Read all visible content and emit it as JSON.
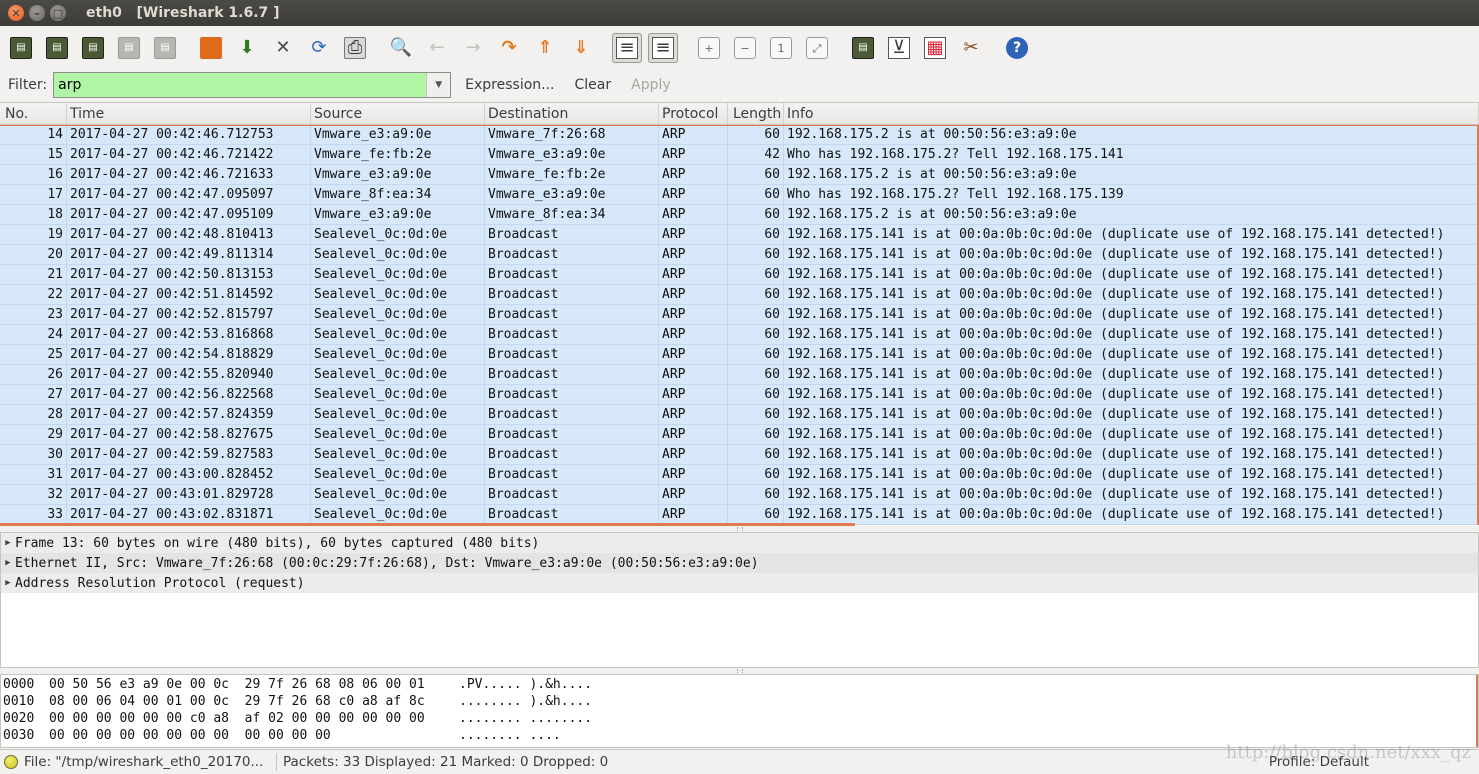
{
  "window": {
    "title": "eth0   [Wireshark 1.6.7 ]",
    "close_glyph": "✕",
    "min_glyph": "–",
    "max_glyph": "□"
  },
  "toolbar": {
    "buttons": [
      {
        "name": "interfaces-list-icon",
        "glyph": "▤"
      },
      {
        "name": "capture-options-icon",
        "glyph": "▤"
      },
      {
        "name": "start-capture-icon",
        "glyph": "▤"
      },
      {
        "name": "stop-capture-icon",
        "glyph": "▤"
      },
      {
        "name": "restart-capture-icon",
        "glyph": "▤"
      },
      {
        "name": "open-file-icon",
        "glyph": ""
      },
      {
        "name": "save-file-icon",
        "glyph": "⬇"
      },
      {
        "name": "close-file-icon",
        "glyph": "✕"
      },
      {
        "name": "reload-icon",
        "glyph": "⟳"
      },
      {
        "name": "print-icon",
        "glyph": "⎙"
      },
      {
        "name": "find-packet-icon",
        "glyph": "🔍"
      },
      {
        "name": "go-back-icon",
        "glyph": "←"
      },
      {
        "name": "go-forward-icon",
        "glyph": "→"
      },
      {
        "name": "go-to-packet-icon",
        "glyph": "↷"
      },
      {
        "name": "go-first-packet-icon",
        "glyph": "⇑"
      },
      {
        "name": "go-last-packet-icon",
        "glyph": "⇓"
      },
      {
        "name": "colorize-icon",
        "glyph": "≡"
      },
      {
        "name": "auto-scroll-icon",
        "glyph": "≡"
      },
      {
        "name": "zoom-in-icon",
        "glyph": "+"
      },
      {
        "name": "zoom-out-icon",
        "glyph": "−"
      },
      {
        "name": "normal-size-icon",
        "glyph": "1"
      },
      {
        "name": "resize-columns-icon",
        "glyph": "⤢"
      },
      {
        "name": "capture-filters-icon",
        "glyph": "▤"
      },
      {
        "name": "display-filters-icon",
        "glyph": "⊻"
      },
      {
        "name": "coloring-rules-icon",
        "glyph": "▦"
      },
      {
        "name": "preferences-icon",
        "glyph": "✂"
      },
      {
        "name": "help-icon",
        "glyph": "?"
      }
    ]
  },
  "filter": {
    "label": "Filter:",
    "value": "arp",
    "expression_label": "Expression...",
    "clear_label": "Clear",
    "apply_label": "Apply",
    "field_color": "#b1f6a6"
  },
  "packet_list": {
    "columns": [
      "No.",
      "Time",
      "Source",
      "Destination",
      "Protocol",
      "Length",
      "Info"
    ],
    "row_color": "#d6e8fa",
    "rows": [
      {
        "no": "14",
        "time": "2017-04-27 00:42:46.712753",
        "src": "Vmware_e3:a9:0e",
        "dst": "Vmware_7f:26:68",
        "proto": "ARP",
        "len": "60",
        "info": "192.168.175.2 is at 00:50:56:e3:a9:0e"
      },
      {
        "no": "15",
        "time": "2017-04-27 00:42:46.721422",
        "src": "Vmware_fe:fb:2e",
        "dst": "Vmware_e3:a9:0e",
        "proto": "ARP",
        "len": "42",
        "info": "Who has 192.168.175.2?  Tell 192.168.175.141"
      },
      {
        "no": "16",
        "time": "2017-04-27 00:42:46.721633",
        "src": "Vmware_e3:a9:0e",
        "dst": "Vmware_fe:fb:2e",
        "proto": "ARP",
        "len": "60",
        "info": "192.168.175.2 is at 00:50:56:e3:a9:0e"
      },
      {
        "no": "17",
        "time": "2017-04-27 00:42:47.095097",
        "src": "Vmware_8f:ea:34",
        "dst": "Vmware_e3:a9:0e",
        "proto": "ARP",
        "len": "60",
        "info": "Who has 192.168.175.2?  Tell 192.168.175.139"
      },
      {
        "no": "18",
        "time": "2017-04-27 00:42:47.095109",
        "src": "Vmware_e3:a9:0e",
        "dst": "Vmware_8f:ea:34",
        "proto": "ARP",
        "len": "60",
        "info": "192.168.175.2 is at 00:50:56:e3:a9:0e"
      },
      {
        "no": "19",
        "time": "2017-04-27 00:42:48.810413",
        "src": "Sealevel_0c:0d:0e",
        "dst": "Broadcast",
        "proto": "ARP",
        "len": "60",
        "info": "192.168.175.141 is at 00:0a:0b:0c:0d:0e (duplicate use of 192.168.175.141 detected!)"
      },
      {
        "no": "20",
        "time": "2017-04-27 00:42:49.811314",
        "src": "Sealevel_0c:0d:0e",
        "dst": "Broadcast",
        "proto": "ARP",
        "len": "60",
        "info": "192.168.175.141 is at 00:0a:0b:0c:0d:0e (duplicate use of 192.168.175.141 detected!)"
      },
      {
        "no": "21",
        "time": "2017-04-27 00:42:50.813153",
        "src": "Sealevel_0c:0d:0e",
        "dst": "Broadcast",
        "proto": "ARP",
        "len": "60",
        "info": "192.168.175.141 is at 00:0a:0b:0c:0d:0e (duplicate use of 192.168.175.141 detected!)"
      },
      {
        "no": "22",
        "time": "2017-04-27 00:42:51.814592",
        "src": "Sealevel_0c:0d:0e",
        "dst": "Broadcast",
        "proto": "ARP",
        "len": "60",
        "info": "192.168.175.141 is at 00:0a:0b:0c:0d:0e (duplicate use of 192.168.175.141 detected!)"
      },
      {
        "no": "23",
        "time": "2017-04-27 00:42:52.815797",
        "src": "Sealevel_0c:0d:0e",
        "dst": "Broadcast",
        "proto": "ARP",
        "len": "60",
        "info": "192.168.175.141 is at 00:0a:0b:0c:0d:0e (duplicate use of 192.168.175.141 detected!)"
      },
      {
        "no": "24",
        "time": "2017-04-27 00:42:53.816868",
        "src": "Sealevel_0c:0d:0e",
        "dst": "Broadcast",
        "proto": "ARP",
        "len": "60",
        "info": "192.168.175.141 is at 00:0a:0b:0c:0d:0e (duplicate use of 192.168.175.141 detected!)"
      },
      {
        "no": "25",
        "time": "2017-04-27 00:42:54.818829",
        "src": "Sealevel_0c:0d:0e",
        "dst": "Broadcast",
        "proto": "ARP",
        "len": "60",
        "info": "192.168.175.141 is at 00:0a:0b:0c:0d:0e (duplicate use of 192.168.175.141 detected!)"
      },
      {
        "no": "26",
        "time": "2017-04-27 00:42:55.820940",
        "src": "Sealevel_0c:0d:0e",
        "dst": "Broadcast",
        "proto": "ARP",
        "len": "60",
        "info": "192.168.175.141 is at 00:0a:0b:0c:0d:0e (duplicate use of 192.168.175.141 detected!)"
      },
      {
        "no": "27",
        "time": "2017-04-27 00:42:56.822568",
        "src": "Sealevel_0c:0d:0e",
        "dst": "Broadcast",
        "proto": "ARP",
        "len": "60",
        "info": "192.168.175.141 is at 00:0a:0b:0c:0d:0e (duplicate use of 192.168.175.141 detected!)"
      },
      {
        "no": "28",
        "time": "2017-04-27 00:42:57.824359",
        "src": "Sealevel_0c:0d:0e",
        "dst": "Broadcast",
        "proto": "ARP",
        "len": "60",
        "info": "192.168.175.141 is at 00:0a:0b:0c:0d:0e (duplicate use of 192.168.175.141 detected!)"
      },
      {
        "no": "29",
        "time": "2017-04-27 00:42:58.827675",
        "src": "Sealevel_0c:0d:0e",
        "dst": "Broadcast",
        "proto": "ARP",
        "len": "60",
        "info": "192.168.175.141 is at 00:0a:0b:0c:0d:0e (duplicate use of 192.168.175.141 detected!)"
      },
      {
        "no": "30",
        "time": "2017-04-27 00:42:59.827583",
        "src": "Sealevel_0c:0d:0e",
        "dst": "Broadcast",
        "proto": "ARP",
        "len": "60",
        "info": "192.168.175.141 is at 00:0a:0b:0c:0d:0e (duplicate use of 192.168.175.141 detected!)"
      },
      {
        "no": "31",
        "time": "2017-04-27 00:43:00.828452",
        "src": "Sealevel_0c:0d:0e",
        "dst": "Broadcast",
        "proto": "ARP",
        "len": "60",
        "info": "192.168.175.141 is at 00:0a:0b:0c:0d:0e (duplicate use of 192.168.175.141 detected!)"
      },
      {
        "no": "32",
        "time": "2017-04-27 00:43:01.829728",
        "src": "Sealevel_0c:0d:0e",
        "dst": "Broadcast",
        "proto": "ARP",
        "len": "60",
        "info": "192.168.175.141 is at 00:0a:0b:0c:0d:0e (duplicate use of 192.168.175.141 detected!)"
      },
      {
        "no": "33",
        "time": "2017-04-27 00:43:02.831871",
        "src": "Sealevel_0c:0d:0e",
        "dst": "Broadcast",
        "proto": "ARP",
        "len": "60",
        "info": "192.168.175.141 is at 00:0a:0b:0c:0d:0e (duplicate use of 192.168.175.141 detected!)"
      }
    ]
  },
  "details": {
    "expander_glyph": "▶",
    "items": [
      "Frame 13: 60 bytes on wire (480 bits), 60 bytes captured (480 bits)",
      "Ethernet II, Src: Vmware_7f:26:68 (00:0c:29:7f:26:68), Dst: Vmware_e3:a9:0e (00:50:56:e3:a9:0e)",
      "Address Resolution Protocol (request)"
    ]
  },
  "hex": {
    "rows": [
      {
        "offset": "0000",
        "bytes": "00 50 56 e3 a9 0e 00 0c  29 7f 26 68 08 06 00 01",
        "ascii": ".PV..... ).&h...."
      },
      {
        "offset": "0010",
        "bytes": "08 00 06 04 00 01 00 0c  29 7f 26 68 c0 a8 af 8c",
        "ascii": "........ ).&h...."
      },
      {
        "offset": "0020",
        "bytes": "00 00 00 00 00 00 c0 a8  af 02 00 00 00 00 00 00",
        "ascii": "........ ........"
      },
      {
        "offset": "0030",
        "bytes": "00 00 00 00 00 00 00 00  00 00 00 00",
        "ascii": "........ ...."
      }
    ]
  },
  "status": {
    "file": "File: \"/tmp/wireshark_eth0_20170...",
    "packets": "Packets: 33 Displayed: 21 Marked: 0 Dropped: 0",
    "profile": "Profile: Default",
    "watermark": "http://blog.csdn.net/xxx_qz"
  }
}
